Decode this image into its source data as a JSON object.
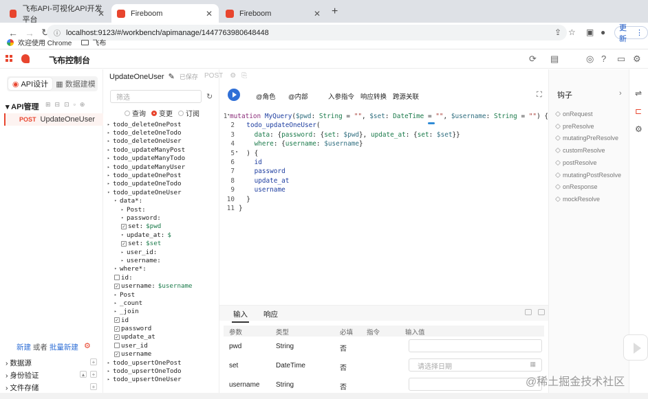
{
  "browser": {
    "tabs": [
      {
        "title": "飞布API-可视化API开发平台",
        "active": false
      },
      {
        "title": "Fireboom",
        "active": true
      },
      {
        "title": "Fireboom",
        "active": false
      }
    ],
    "url": "localhost:9123/#/workbench/apimanage/1447763980648448",
    "update_label": "更新",
    "bookmarks": [
      {
        "label": "欢迎使用 Chrome",
        "icon": "chrome-icon"
      },
      {
        "label": "飞布",
        "icon": "folder-icon"
      }
    ]
  },
  "app": {
    "title": "飞布控制台",
    "accent_color": "#e8452e"
  },
  "sidebar": {
    "tabs": [
      "API设计",
      "数据建模"
    ],
    "section_title": "API管理",
    "api_item": {
      "method": "POST",
      "name": "UpdateOneUser"
    },
    "new_link": "新建",
    "or_text": " 或者 ",
    "batch_link": "批量新建",
    "sections": [
      "数据源",
      "身份验证",
      "文件存储"
    ]
  },
  "operation": {
    "name": "UpdateOneUser",
    "status": "已保存",
    "method": "POST",
    "save_label": "保存"
  },
  "explorer": {
    "filter_placeholder": "筛选",
    "op_types": [
      "查询",
      "变更",
      "订阅"
    ],
    "tree": [
      {
        "depth": 0,
        "arrow": "▸",
        "text": "todo_deleteOnePost"
      },
      {
        "depth": 0,
        "arrow": "▸",
        "text": "todo_deleteOneTodo"
      },
      {
        "depth": 0,
        "arrow": "▸",
        "text": "todo_deleteOneUser"
      },
      {
        "depth": 0,
        "arrow": "▸",
        "text": "todo_updateManyPost"
      },
      {
        "depth": 0,
        "arrow": "▸",
        "text": "todo_updateManyTodo"
      },
      {
        "depth": 0,
        "arrow": "▸",
        "text": "todo_updateManyUser"
      },
      {
        "depth": 0,
        "arrow": "▸",
        "text": "todo_updateOnePost"
      },
      {
        "depth": 0,
        "arrow": "▸",
        "text": "todo_updateOneTodo"
      },
      {
        "depth": 0,
        "arrow": "▾",
        "text": "todo_updateOneUser"
      },
      {
        "depth": 1,
        "arrow": "▾",
        "text": "data*:"
      },
      {
        "depth": 2,
        "arrow": "▸",
        "text": "Post:"
      },
      {
        "depth": 2,
        "arrow": "▾",
        "text": "password:"
      },
      {
        "depth": 2,
        "cb": "chk",
        "text": "set:",
        "var": "$pwd"
      },
      {
        "depth": 2,
        "arrow": "▾",
        "text": "update_at:",
        "var": "$"
      },
      {
        "depth": 2,
        "cb": "chk",
        "text": "set:",
        "var": "$set"
      },
      {
        "depth": 2,
        "arrow": "▸",
        "text": "user_id:"
      },
      {
        "depth": 2,
        "arrow": "▸",
        "text": "username:"
      },
      {
        "depth": 1,
        "arrow": "▾",
        "text": "where*:"
      },
      {
        "depth": 1,
        "cb": "off",
        "text": "id:"
      },
      {
        "depth": 1,
        "cb": "chk",
        "text": "username:",
        "var": "$username"
      },
      {
        "depth": 1,
        "arrow": "▸",
        "text": "Post"
      },
      {
        "depth": 1,
        "arrow": "▸",
        "text": "_count"
      },
      {
        "depth": 1,
        "arrow": "▸",
        "text": "_join"
      },
      {
        "depth": 1,
        "cb": "chk",
        "text": "id"
      },
      {
        "depth": 1,
        "cb": "chk",
        "text": "password"
      },
      {
        "depth": 1,
        "cb": "chk",
        "text": "update_at"
      },
      {
        "depth": 1,
        "cb": "off",
        "text": "user_id"
      },
      {
        "depth": 1,
        "cb": "chk",
        "text": "username"
      },
      {
        "depth": 0,
        "arrow": "▸",
        "text": "todo_upsertOnePost"
      },
      {
        "depth": 0,
        "arrow": "▸",
        "text": "todo_upsertOneTodo"
      },
      {
        "depth": 0,
        "arrow": "▸",
        "text": "todo_upsertOneUser"
      }
    ]
  },
  "editor": {
    "toolbar": [
      "@角色",
      "@内部",
      "入参指令",
      "响应转换",
      "跨源关联"
    ],
    "code": [
      {
        "n": "1",
        "fold": "▾",
        "html": "<span class=\"kw\">mutation</span> <span class=\"fn\">MyQuery</span>(<span class=\"vr\">$pwd</span>: <span class=\"ty\">String</span> = <span class=\"str\">\"\"</span>, <span class=\"vr\">$set</span>: <span class=\"ty\">DateTime</span> = <span class=\"str\">\"\"</span>, <span class=\"vr\">$username</span>: <span class=\"ty\">String</span> = <span class=\"str\">\"\"</span>) {"
      },
      {
        "n": "2",
        "fold": "",
        "html": "  <span class=\"fn\">todo_updateOneUser</span>("
      },
      {
        "n": "3",
        "fold": "",
        "html": "    <span class=\"ty\">data</span>: {<span class=\"ty\">password</span>: {<span class=\"ty\">set</span>: <span class=\"vr\">$pwd</span>}, <span class=\"ty\">update_at</span>: {<span class=\"ty\">set</span>: <span class=\"vr\">$set</span>}}"
      },
      {
        "n": "4",
        "fold": "",
        "html": "    <span class=\"ty\">where</span>: {<span class=\"ty\">username</span>: <span class=\"vr\">$username</span>}"
      },
      {
        "n": "5",
        "fold": "▾",
        "html": "  ) {"
      },
      {
        "n": "6",
        "fold": "",
        "html": "    <span class=\"fn\">id</span>"
      },
      {
        "n": "7",
        "fold": "",
        "html": "    <span class=\"fn\">password</span>"
      },
      {
        "n": "8",
        "fold": "",
        "html": "    <span class=\"fn\">update_at</span>"
      },
      {
        "n": "9",
        "fold": "",
        "html": "    <span class=\"fn\">username</span>"
      },
      {
        "n": "10",
        "fold": "",
        "html": "  }"
      },
      {
        "n": "11",
        "fold": "",
        "html": "}"
      }
    ]
  },
  "params": {
    "tabs": [
      "输入",
      "响应"
    ],
    "columns": [
      "参数",
      "类型",
      "必填",
      "指令",
      "输入值"
    ],
    "rows": [
      {
        "name": "pwd",
        "type": "String",
        "required": "否",
        "placeholder": ""
      },
      {
        "name": "set",
        "type": "DateTime",
        "required": "否",
        "placeholder": "请选择日期"
      },
      {
        "name": "username",
        "type": "String",
        "required": "否",
        "placeholder": ""
      }
    ]
  },
  "hooks": {
    "title": "钩子",
    "items": [
      "onRequest",
      "preResolve",
      "mutatingPreResolve",
      "customResolve",
      "postResolve",
      "mutatingPostResolve",
      "onResponse",
      "mockResolve"
    ]
  },
  "watermark": "@稀土掘金技术社区"
}
